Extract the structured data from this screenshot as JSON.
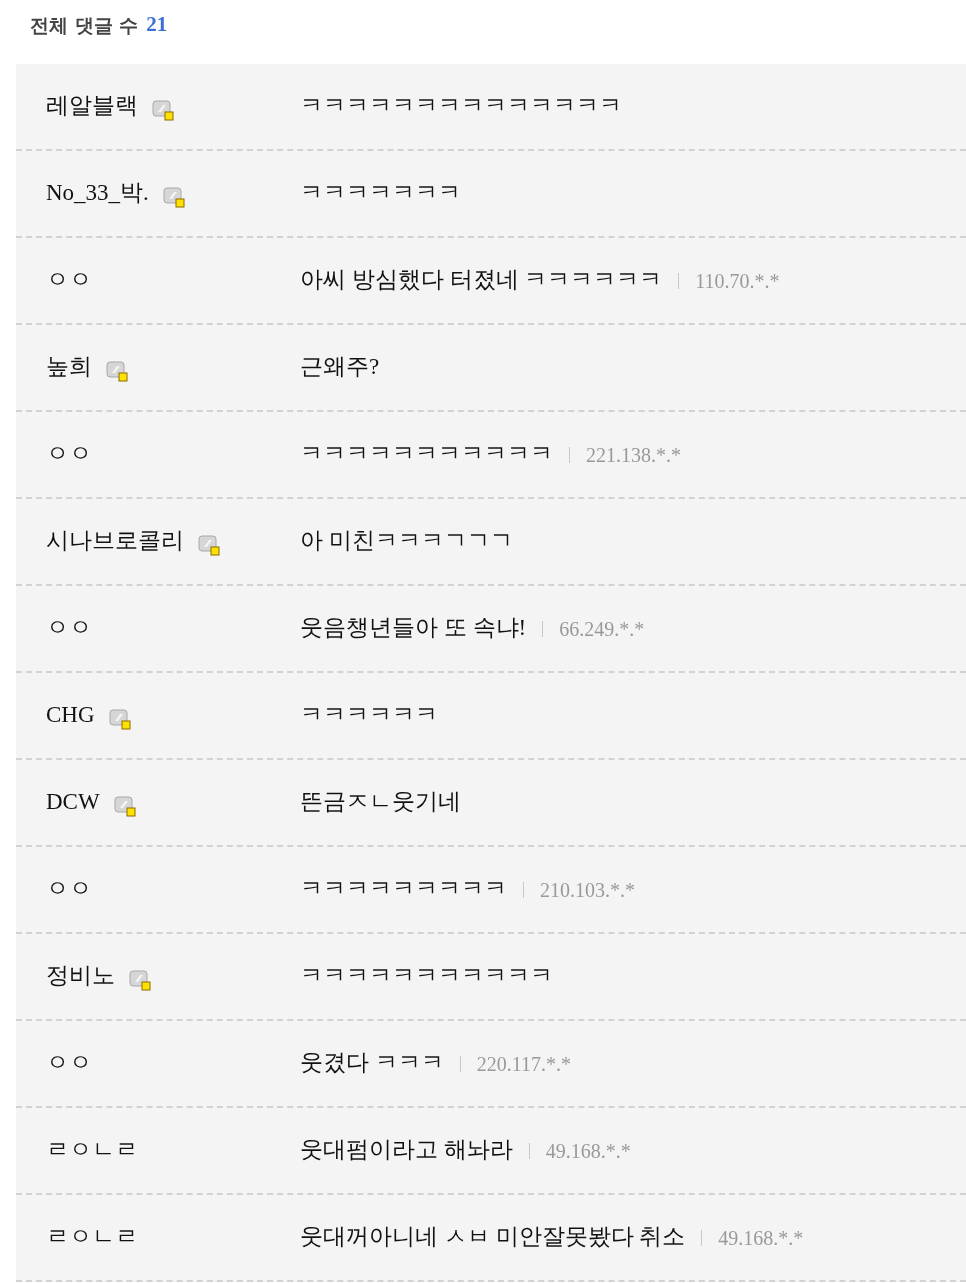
{
  "header": {
    "label": "전체 댓글 수",
    "count": "21"
  },
  "comments": [
    {
      "nickname": "레알블랙",
      "member": true,
      "text": "ㅋㅋㅋㅋㅋㅋㅋㅋㅋㅋㅋㅋㅋㅋ"
    },
    {
      "nickname": "No_33_박.",
      "member": true,
      "text": "ㅋㅋㅋㅋㅋㅋㅋ"
    },
    {
      "nickname": "ㅇㅇ",
      "member": false,
      "text": "아씨 방심했다 터졌네 ㅋㅋㅋㅋㅋㅋ",
      "ip": "110.70.*.*"
    },
    {
      "nickname": "높희",
      "member": true,
      "text": "근왜주?"
    },
    {
      "nickname": "ㅇㅇ",
      "member": false,
      "text": "ㅋㅋㅋㅋㅋㅋㅋㅋㅋㅋㅋ",
      "ip": "221.138.*.*"
    },
    {
      "nickname": "시나브로콜리",
      "member": true,
      "text": "아 미친ㅋㅋㅋㄱㄱㄱ"
    },
    {
      "nickname": "ㅇㅇ",
      "member": false,
      "text": "웃음챙년들아 또 속냐!",
      "ip": "66.249.*.*"
    },
    {
      "nickname": "CHG",
      "member": true,
      "text": "ㅋㅋㅋㅋㅋㅋ"
    },
    {
      "nickname": "DCW",
      "member": true,
      "text": "뜬금ㅈㄴ웃기네"
    },
    {
      "nickname": "ㅇㅇ",
      "member": false,
      "text": "ㅋㅋㅋㅋㅋㅋㅋㅋㅋ",
      "ip": "210.103.*.*"
    },
    {
      "nickname": "정비노",
      "member": true,
      "text": "ㅋㅋㅋㅋㅋㅋㅋㅋㅋㅋㅋ"
    },
    {
      "nickname": "ㅇㅇ",
      "member": false,
      "text": "웃겼다 ㅋㅋㅋ",
      "ip": "220.117.*.*"
    },
    {
      "nickname": "ㄹㅇㄴㄹ",
      "member": false,
      "text": "웃대펌이라고 해놔라",
      "ip": "49.168.*.*"
    },
    {
      "nickname": "ㄹㅇㄴㄹ",
      "member": false,
      "text": "웃대꺼아니네 ㅅㅂ 미안잘못봤다 취소",
      "ip": "49.168.*.*"
    }
  ]
}
